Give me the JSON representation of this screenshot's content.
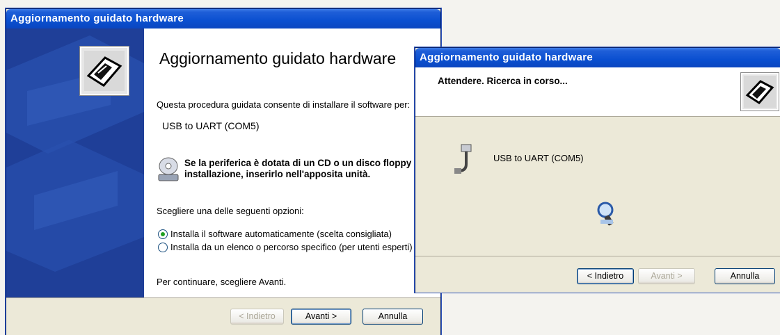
{
  "left_window": {
    "title": "Aggiornamento guidato hardware",
    "heading": "Aggiornamento guidato hardware",
    "intro": "Questa procedura guidata consente di installare il software per:",
    "device": "USB to UART (COM5)",
    "cd_notice": "Se la periferica è dotata di un CD o un disco floppy di installazione, inserirlo nell'apposita unità.",
    "options_label": "Scegliere una delle seguenti opzioni:",
    "options": [
      {
        "label": "Installa il software automaticamente (scelta consigliata)",
        "selected": true
      },
      {
        "label": "Installa da un elenco o percorso specifico (per utenti esperti)",
        "selected": false
      }
    ],
    "continue_text": "Per continuare, scegliere Avanti.",
    "buttons": {
      "back": "< Indietro",
      "next": "Avanti >",
      "cancel": "Annulla"
    }
  },
  "right_window": {
    "title": "Aggiornamento guidato hardware",
    "status": "Attendere. Ricerca in corso...",
    "device": "USB to UART (COM5)",
    "buttons": {
      "back": "< Indietro",
      "next": "Avanti >",
      "cancel": "Annulla"
    }
  },
  "colors": {
    "titlebar": "#0a4fd0",
    "side_panel": "#1f3f98",
    "dialog_bg": "#ece9d8"
  },
  "icons": [
    "hardware-wizard-icon",
    "cd-drive-icon",
    "usb-device-icon",
    "search-magnifier-icon"
  ]
}
